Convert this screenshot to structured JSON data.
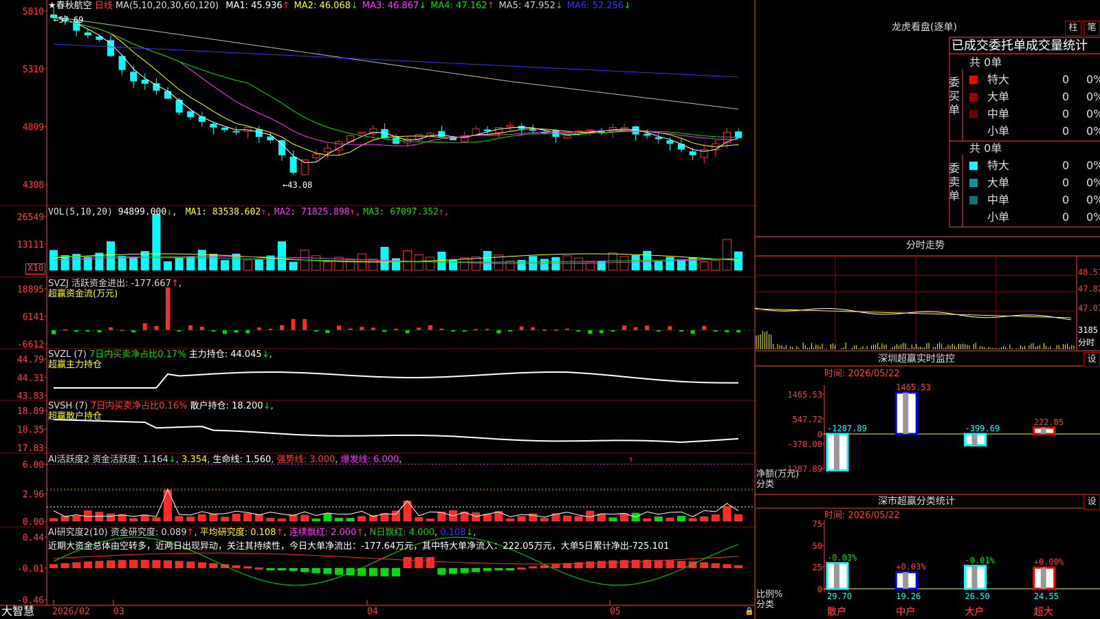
{
  "colors": {
    "up": "#ff2a2a",
    "down": "#00ffff",
    "grid": "#8b0000",
    "axis": "#ff3c3c",
    "yellow": "#ffff00",
    "magenta": "#ff33ff",
    "green": "#00dd00",
    "white": "#ffffff",
    "gray": "#bbbbbb",
    "blue": "#3333ff"
  },
  "kline": {
    "title": "★春秋航空",
    "period": "日线",
    "ma_title": "MA(5,10,20,30,60,120)",
    "ma": [
      {
        "label": "MA1: 45.936",
        "arrow": "↑",
        "color": "#ffffff"
      },
      {
        "label": "MA2: 46.068",
        "arrow": "↓",
        "color": "#ffff00"
      },
      {
        "label": "MA3: 46.867",
        "arrow": "↓",
        "color": "#ff33ff"
      },
      {
        "label": "MA4: 47.162",
        "arrow": "↑",
        "color": "#00dd00"
      },
      {
        "label": "MA5: 47.952",
        "arrow": "↓",
        "color": "#cccccc"
      },
      {
        "label": "MA6: 52.256",
        "arrow": "↓",
        "color": "#3333ff"
      }
    ],
    "yticks": [
      "5810",
      "5310",
      "4809",
      "4308"
    ],
    "high_label": "57.69",
    "low_label": "43.08"
  },
  "vol": {
    "title": "VOL(5,10,20)",
    "value": "94899.000",
    "arrow": "↓",
    "ma": [
      {
        "label": "MA1: 83538.602",
        "arrow": "↑",
        "color": "#ffff00"
      },
      {
        "label": "MA2: 71825.898",
        "arrow": "↑",
        "color": "#ff33ff"
      },
      {
        "label": "MA3: 67097.352",
        "arrow": "↑",
        "color": "#00dd00"
      }
    ],
    "yticks": [
      "26549",
      "13111"
    ],
    "unit": "X10"
  },
  "svzj": {
    "title": "SVZJ  活跃资金进出: -177.667",
    "arrow": "↑",
    "sub": "超赢资金流(万元)",
    "yticks": [
      "18895",
      "6141",
      "-6612"
    ]
  },
  "svzl": {
    "title": "SVZL (7)",
    "t1": "7日内买卖净占比0.17%",
    "t2": "主力持仓: 44.045",
    "arrow": "↓",
    "sub": "超赢主力持仓",
    "yticks": [
      "44.79",
      "44.31",
      "43.83"
    ]
  },
  "svsh": {
    "title": "SVSH (7)",
    "t1": "7日内买卖净占比0.16%",
    "t2": "散户持仓: 18.200",
    "arrow": "↓",
    "sub": "超赢散户持仓",
    "yticks": [
      "18.89",
      "18.35",
      "17.83"
    ]
  },
  "ai_act": {
    "title": "AI活跃度2 资金活跃度: 1.164",
    "a1": "↓",
    "v2": "3.354",
    "l3": "生命线: 1.560",
    "l4": "强势线: 3.000",
    "l5": "爆发线: 6.000",
    "yticks": [
      "6.00",
      "2.96",
      "0.00"
    ]
  },
  "ai_res": {
    "title": "AI研究度2(10) 资金研究度: 0.089",
    "a1": "↑",
    "l2": "平均研究度: 0.108",
    "a2": "↑",
    "l3": "连续飘红: 2.000",
    "a3": "↑",
    "l4": "N日飘红: 4.000",
    "l5": "0.108",
    "a5": "↓",
    "note": "近期大资金总体由空转多，近两日出现异动，关注其持续性，今日大单净流出：-177.64万元，其中特大单净流入：222.05万元，大单5日累计净出-725.101",
    "yticks": [
      "0.44",
      "-0.01",
      "-0.46"
    ]
  },
  "xaxis": {
    "brand": "大智慧",
    "labels": [
      "2026/02",
      "03",
      "04",
      "05"
    ]
  },
  "longhu": {
    "title": "龙虎看盘(逐单)",
    "btn1": "柱",
    "btn2": "笔",
    "header": "已成交委托单成交量统计",
    "buy": {
      "side": "委买单",
      "total": "共 0单",
      "rows": [
        {
          "name": "特大",
          "v": "0",
          "p": "0%",
          "c": "#ff0000"
        },
        {
          "name": "大单",
          "v": "0",
          "p": "0%",
          "c": "#990000"
        },
        {
          "name": "中单",
          "v": "0",
          "p": "0%",
          "c": "#660000"
        },
        {
          "name": "小单",
          "v": "0",
          "p": "0%",
          "c": "#000000"
        }
      ]
    },
    "sell": {
      "side": "委卖单",
      "total": "共 0单",
      "rows": [
        {
          "name": "特大",
          "v": "0",
          "p": "0%",
          "c": "#00ffff"
        },
        {
          "name": "大单",
          "v": "0",
          "p": "0%",
          "c": "#009999"
        },
        {
          "name": "中单",
          "v": "0",
          "p": "0%",
          "c": "#007777"
        },
        {
          "name": "小单",
          "v": "0",
          "p": "0%",
          "c": "#000000"
        }
      ]
    }
  },
  "fenshi": {
    "title": "分时走势",
    "yticks": [
      "48.57",
      "47.82",
      "47.07",
      "3185",
      "分时"
    ]
  },
  "sz_monitor": {
    "title": "深圳超赢实时监控",
    "btn": "设",
    "time": "时间: 2026/05/22",
    "yticks": [
      "1465.53",
      "547.72",
      "0",
      "-370.08",
      "-1287.89"
    ],
    "ylabel": "净额(万元)",
    "xlabel": "分类",
    "chart_data": {
      "type": "bar",
      "categories": [
        "散户",
        "中户",
        "大户",
        "超大"
      ],
      "values": [
        -1287.89,
        1465.53,
        -399.69,
        222.05
      ],
      "labels": [
        "-1287.89",
        "1465.53",
        "-399.69",
        "222.05"
      ],
      "ylim": [
        -1287.89,
        1465.53
      ],
      "ylabel": "净额(万元)",
      "xlabel": "分类"
    }
  },
  "sz_class": {
    "title": "深市超赢分类统计",
    "btn": "设",
    "time": "时间: 2026/05/22",
    "yticks": [
      "75",
      "50",
      "25",
      "0"
    ],
    "ylabel": "比例%",
    "xlabel": "分类",
    "chart_data": {
      "type": "bar",
      "categories": [
        "散户",
        "中户",
        "大户",
        "超大"
      ],
      "values": [
        29.7,
        19.26,
        26.5,
        24.55
      ],
      "changes": [
        "-0.03%",
        "+0.03%",
        "-0.01%",
        "+0.00%"
      ],
      "labels": [
        "29.70",
        "19.26",
        "26.50",
        "24.55"
      ],
      "ylim": [
        0,
        75
      ],
      "ylabel": "比例%",
      "xlabel": "分类"
    }
  }
}
